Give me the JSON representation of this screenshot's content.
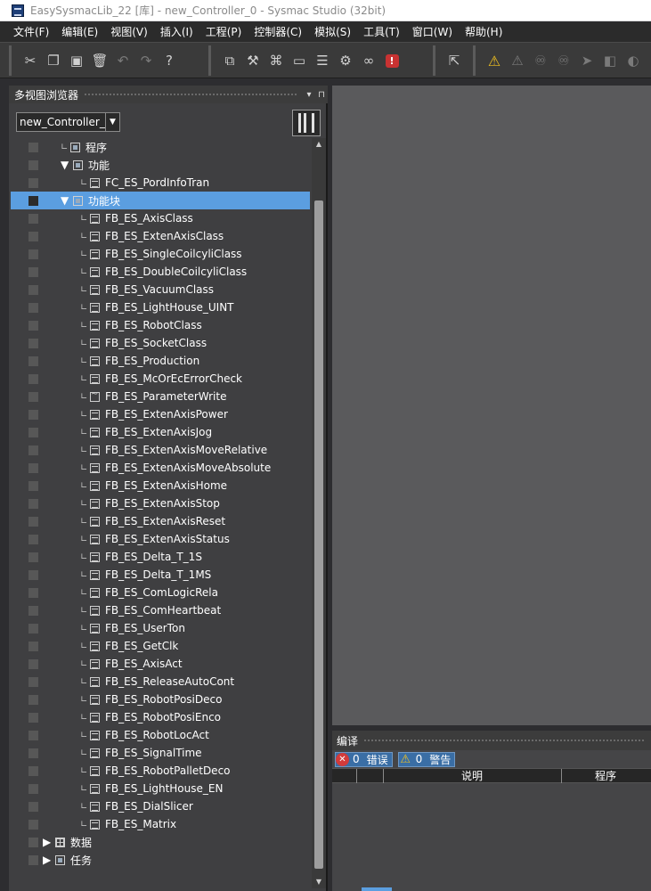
{
  "window": {
    "title": "EasySysmacLib_22 [库] - new_Controller_0 - Sysmac Studio (32bit)"
  },
  "menu": [
    "文件(F)",
    "编辑(E)",
    "视图(V)",
    "插入(I)",
    "工程(P)",
    "控制器(C)",
    "模拟(S)",
    "工具(T)",
    "窗口(W)",
    "帮助(H)"
  ],
  "toolbar": {
    "group1": [
      "cut-icon",
      "copy-icon",
      "paste-icon",
      "delete-icon",
      "undo-icon",
      "redo-icon",
      "help-icon"
    ],
    "group2": [
      "build-icon",
      "hammer-icon",
      "network-icon",
      "window-icon",
      "list-icon",
      "rebuild-icon",
      "binoculars-icon",
      "error-icon"
    ],
    "group3": [
      "cursor-icon"
    ],
    "group4": [
      "warning-icon",
      "warning-dim-icon",
      "trace-icon",
      "trace-dim-icon",
      "arrow-dim-icon",
      "stack-dim-icon",
      "more-dim-icon"
    ]
  },
  "left_panel": {
    "title": "多视图浏览器",
    "pin_label": "▾ ⊓",
    "controller": "new_Controller_0",
    "tree": [
      {
        "label": "程序",
        "icon": "prog",
        "expander": "",
        "depth": 1
      },
      {
        "label": "功能",
        "icon": "prog",
        "expander": "▼",
        "depth": 1
      },
      {
        "label": "FC_ES_PordInfoTran",
        "icon": "doc",
        "expander": "",
        "depth": 2
      },
      {
        "label": "功能块",
        "icon": "prog",
        "expander": "▼",
        "depth": 1,
        "selected": true
      },
      {
        "label": "FB_ES_AxisClass",
        "icon": "doc",
        "expander": "",
        "depth": 2
      },
      {
        "label": "FB_ES_ExtenAxisClass",
        "icon": "doc",
        "expander": "",
        "depth": 2
      },
      {
        "label": "FB_ES_SingleCoilcyliClass",
        "icon": "doc",
        "expander": "",
        "depth": 2
      },
      {
        "label": "FB_ES_DoubleCoilcyliClass",
        "icon": "doc",
        "expander": "",
        "depth": 2
      },
      {
        "label": "FB_ES_VacuumClass",
        "icon": "doc",
        "expander": "",
        "depth": 2
      },
      {
        "label": "FB_ES_LightHouse_UINT",
        "icon": "doc",
        "expander": "",
        "depth": 2
      },
      {
        "label": "FB_ES_RobotClass",
        "icon": "doc",
        "expander": "",
        "depth": 2
      },
      {
        "label": "FB_ES_SocketClass",
        "icon": "doc",
        "expander": "",
        "depth": 2
      },
      {
        "label": "FB_ES_Production",
        "icon": "doc",
        "expander": "",
        "depth": 2
      },
      {
        "label": "FB_ES_McOrEcErrorCheck",
        "icon": "doc",
        "expander": "",
        "depth": 2
      },
      {
        "label": "FB_ES_ParameterWrite",
        "icon": "wave",
        "expander": "",
        "depth": 2
      },
      {
        "label": "FB_ES_ExtenAxisPower",
        "icon": "doc",
        "expander": "",
        "depth": 2
      },
      {
        "label": "FB_ES_ExtenAxisJog",
        "icon": "doc",
        "expander": "",
        "depth": 2
      },
      {
        "label": "FB_ES_ExtenAxisMoveRelative",
        "icon": "doc",
        "expander": "",
        "depth": 2
      },
      {
        "label": "FB_ES_ExtenAxisMoveAbsolute",
        "icon": "doc",
        "expander": "",
        "depth": 2
      },
      {
        "label": "FB_ES_ExtenAxisHome",
        "icon": "doc",
        "expander": "",
        "depth": 2
      },
      {
        "label": "FB_ES_ExtenAxisStop",
        "icon": "doc",
        "expander": "",
        "depth": 2
      },
      {
        "label": "FB_ES_ExtenAxisReset",
        "icon": "doc",
        "expander": "",
        "depth": 2
      },
      {
        "label": "FB_ES_ExtenAxisStatus",
        "icon": "doc",
        "expander": "",
        "depth": 2
      },
      {
        "label": "FB_ES_Delta_T_1S",
        "icon": "doc",
        "expander": "",
        "depth": 2
      },
      {
        "label": "FB_ES_Delta_T_1MS",
        "icon": "doc",
        "expander": "",
        "depth": 2
      },
      {
        "label": "FB_ES_ComLogicRela",
        "icon": "doc",
        "expander": "",
        "depth": 2
      },
      {
        "label": "FB_ES_ComHeartbeat",
        "icon": "doc",
        "expander": "",
        "depth": 2
      },
      {
        "label": "FB_ES_UserTon",
        "icon": "doc",
        "expander": "",
        "depth": 2
      },
      {
        "label": "FB_ES_GetClk",
        "icon": "doc",
        "expander": "",
        "depth": 2
      },
      {
        "label": "FB_ES_AxisAct",
        "icon": "doc",
        "expander": "",
        "depth": 2
      },
      {
        "label": "FB_ES_ReleaseAutoCont",
        "icon": "doc",
        "expander": "",
        "depth": 2
      },
      {
        "label": "FB_ES_RobotPosiDeco",
        "icon": "doc",
        "expander": "",
        "depth": 2
      },
      {
        "label": "FB_ES_RobotPosiEnco",
        "icon": "doc",
        "expander": "",
        "depth": 2
      },
      {
        "label": "FB_ES_RobotLocAct",
        "icon": "doc",
        "expander": "",
        "depth": 2
      },
      {
        "label": "FB_ES_SignalTime",
        "icon": "doc",
        "expander": "",
        "depth": 2
      },
      {
        "label": "FB_ES_RobotPalletDeco",
        "icon": "doc",
        "expander": "",
        "depth": 2
      },
      {
        "label": "FB_ES_LightHouse_EN",
        "icon": "doc",
        "expander": "",
        "depth": 2
      },
      {
        "label": "FB_ES_DialSlicer",
        "icon": "doc",
        "expander": "",
        "depth": 2
      },
      {
        "label": "FB_ES_Matrix",
        "icon": "doc",
        "expander": "",
        "depth": 2
      },
      {
        "label": "数据",
        "icon": "grid",
        "expander": "▶",
        "depth": 0
      },
      {
        "label": "任务",
        "icon": "prog",
        "expander": "▶",
        "depth": 0
      }
    ]
  },
  "compile_panel": {
    "title": "编译",
    "errors_count": "0",
    "errors_label": "错误",
    "warnings_count": "0",
    "warnings_label": "警告",
    "columns": [
      "说明",
      "程序"
    ]
  },
  "colors": {
    "selected_row": "#5b9ee0",
    "panel_bg": "#3f3f41",
    "editor_bg": "#5a5a5c",
    "filter_btn": "#3a6ea5"
  }
}
